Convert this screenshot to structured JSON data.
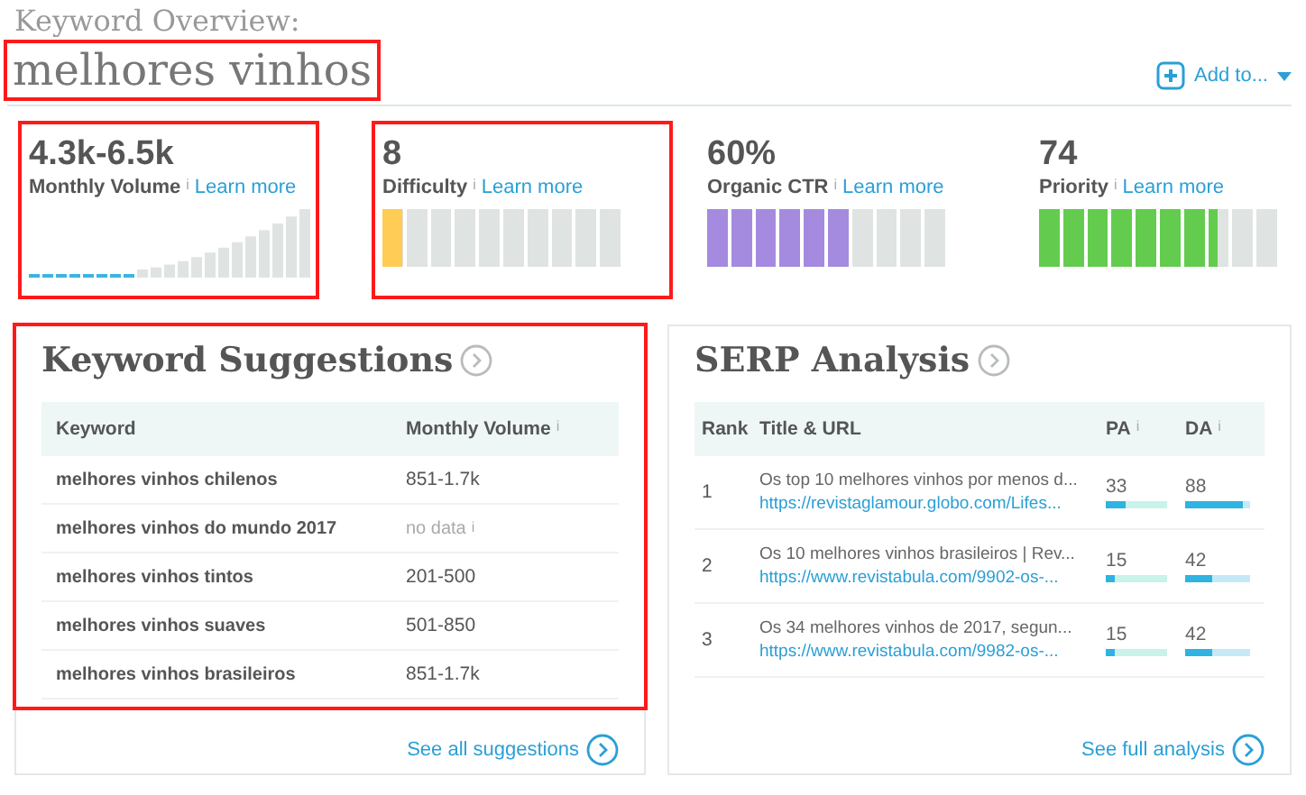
{
  "header": {
    "kicker": "Keyword Overview:",
    "keyword": "melhores vinhos",
    "highlighted": true,
    "add_button": "Add to..."
  },
  "metrics": [
    {
      "kind": "trend",
      "value": "4.3k-6.5k",
      "label": "Monthly Volume",
      "info": "i",
      "link": "Learn more",
      "highlighted": true
    },
    {
      "kind": "segments",
      "value": "8",
      "label": "Difficulty",
      "info": "i",
      "link": "Learn more",
      "highlighted": true,
      "level": 0.08,
      "color": "#ffcc55"
    },
    {
      "kind": "segments",
      "value": "60%",
      "label": "Organic CTR",
      "info": "i",
      "link": "Learn more",
      "highlighted": false,
      "level": 0.6,
      "color": "#a48be0"
    },
    {
      "kind": "segments",
      "value": "74",
      "label": "Priority",
      "info": "i",
      "link": "Learn more",
      "highlighted": false,
      "level": 0.74,
      "color": "#63cc4f"
    }
  ],
  "suggestions": {
    "title": "Keyword Suggestions",
    "highlighted": true,
    "columns": [
      {
        "label": "Keyword"
      },
      {
        "label": "Monthly Volume",
        "info": "i"
      }
    ],
    "rows": [
      {
        "keyword": "melhores vinhos chilenos",
        "volume": "851-1.7k",
        "no_data": false
      },
      {
        "keyword": "melhores vinhos do mundo 2017",
        "volume": "no data",
        "no_data": true,
        "info": "i"
      },
      {
        "keyword": "melhores vinhos tintos",
        "volume": "201-500",
        "no_data": false
      },
      {
        "keyword": "melhores vinhos suaves",
        "volume": "501-850",
        "no_data": false
      },
      {
        "keyword": "melhores vinhos brasileiros",
        "volume": "851-1.7k",
        "no_data": false
      }
    ],
    "footer_link": "See all suggestions"
  },
  "serp": {
    "title": "SERP Analysis",
    "columns": [
      {
        "label": "Rank"
      },
      {
        "label": "Title & URL"
      },
      {
        "label": "PA",
        "info": "i"
      },
      {
        "label": "DA",
        "info": "i"
      }
    ],
    "rows": [
      {
        "rank": "1",
        "title": "Os top 10 melhores vinhos por menos d...",
        "url": "https://revistaglamour.globo.com/Lifes...",
        "pa": {
          "value": "33",
          "level": 0.33
        },
        "da": {
          "value": "88",
          "level": 0.88
        }
      },
      {
        "rank": "2",
        "title": "Os 10 melhores vinhos brasileiros | Rev...",
        "url": "https://www.revistabula.com/9902-os-...",
        "pa": {
          "value": "15",
          "level": 0.15
        },
        "da": {
          "value": "42",
          "level": 0.42
        }
      },
      {
        "rank": "3",
        "title": "Os 34 melhores vinhos de 2017, segun...",
        "url": "https://www.revistabula.com/9982-os-...",
        "pa": {
          "value": "15",
          "level": 0.15
        },
        "da": {
          "value": "42",
          "level": 0.42
        }
      }
    ],
    "footer_link": "See full analysis"
  }
}
